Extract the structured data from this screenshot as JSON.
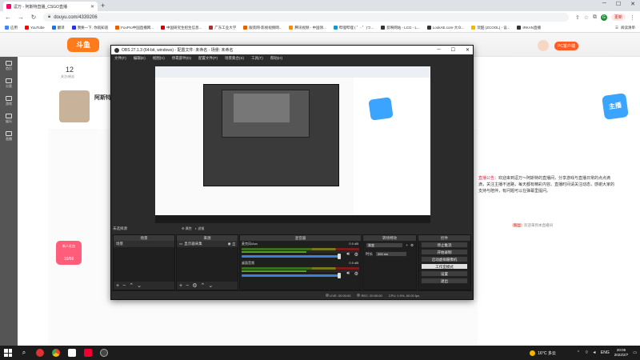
{
  "browser": {
    "tab_title": "逗万 - 阿斯特直播_CSGO直播",
    "url": "douyu.com/4339206",
    "update_label": "更新",
    "avatar_letter": "G",
    "bookmarks": [
      {
        "label": "应用",
        "color": "#4285f4"
      },
      {
        "label": "YouTube",
        "color": "#ff0000"
      },
      {
        "label": "翻译",
        "color": "#1a73e8"
      },
      {
        "label": "我要一下, 你就知道",
        "color": "#2932e1"
      },
      {
        "label": "FoxPro中国直播网...",
        "color": "#e66000"
      },
      {
        "label": "中国研究生招生信息...",
        "color": "#c00"
      },
      {
        "label": "广东工业大学",
        "color": "#a33"
      },
      {
        "label": "服装网-影视视频网...",
        "color": "#d60"
      },
      {
        "label": "腾讯视频 - 中国领...",
        "color": "#ff8a00"
      },
      {
        "label": "哔哩哔哩 ( ゜- ゜)つ...",
        "color": "#00a1d6"
      },
      {
        "label": "剪映网站 - LCG - L...",
        "color": "#333"
      },
      {
        "label": "LookAE.com-大众...",
        "color": "#333"
      },
      {
        "label": "玩酷 (ZCOOL) - 设...",
        "color": "#f5b400"
      },
      {
        "label": "iRKAN直播",
        "color": "#333"
      }
    ],
    "reading_list": "阅读清单"
  },
  "douyu": {
    "logo_text": "斗鱼",
    "pc_client": "PC客户端",
    "fans_count": "12",
    "fans_label": "关注/粉丝",
    "anchor_name": "阿斯特",
    "badge_text": "主播",
    "gift_title": "新人礼包",
    "gift_count": "10/66",
    "leftnav": [
      "首页",
      "分类",
      "游戏",
      "娱乐",
      "直播"
    ],
    "notice_prefix": "直播公告：",
    "notice_text": "欢迎来到逗万～阿斯特的直播间，分享游戏与直播日常的点点滴滴，关注主播不迷路，每天都有精彩内容。直播时间请关注动态，感谢大家的支持与陪伴，有问题可以在弹幕里提问。",
    "chat_tag": "粉丝",
    "chat_text": "欢迎来到本直播间"
  },
  "obs": {
    "title": "OBS 27.1.3 (64-bit, windows) - 配置文件: 未命名 - 场景: 未命名",
    "menu": [
      "文件(F)",
      "编辑(E)",
      "视图(V)",
      "停靠部件(D)",
      "配置文件(P)",
      "场景集合(S)",
      "工具(T)",
      "帮助(H)"
    ],
    "scene_label": "未选择源",
    "filter_buttons": [
      "属性",
      "滤镜"
    ],
    "docks": {
      "scenes": {
        "title": "场景",
        "items": [
          "场景"
        ]
      },
      "sources": {
        "title": "来源",
        "items": [
          "显示器采集"
        ]
      },
      "mixer": {
        "title": "混音器",
        "channels": [
          {
            "name": "麦克风/Aux",
            "db": "0.0 dB"
          },
          {
            "name": "桌面音频",
            "db": "0.0 dB"
          }
        ]
      },
      "transitions": {
        "title": "转场特效",
        "type": "渐变",
        "duration_label": "时长",
        "duration": "300 ms"
      },
      "controls": {
        "title": "控件",
        "buttons": [
          {
            "label": "停止推流",
            "active": false
          },
          {
            "label": "开始录制",
            "active": false
          },
          {
            "label": "启动虚拟摄像机",
            "active": false
          },
          {
            "label": "工作室模式",
            "active": true
          },
          {
            "label": "设置",
            "active": false
          },
          {
            "label": "退出",
            "active": false
          }
        ]
      }
    },
    "status": {
      "live": "LIVE: 00:00:00",
      "rec": "REC: 00:00:00",
      "cpu": "CPU: 0.9%, 60.00 fps"
    }
  },
  "taskbar": {
    "weather": "16°C  多云",
    "lang": "ENG",
    "time": "20:05",
    "date": "2022/2/7"
  }
}
